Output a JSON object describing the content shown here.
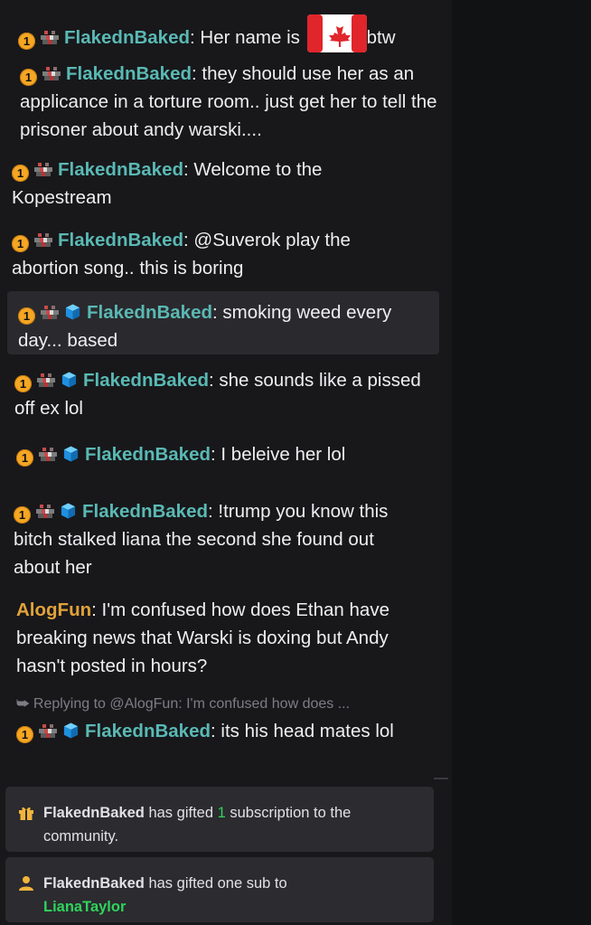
{
  "username": "FlakednBaked",
  "badge_one": "1",
  "messages": [
    {
      "text": "Her name is ",
      "tail": "btw"
    },
    {
      "text": "they should use her as an applicance in a torture room.. just get her to tell the prisoner about andy warski...."
    },
    {
      "text": "Welcome to the Kopestream"
    },
    {
      "text": "@Suverok play the abortion song.. this is boring"
    },
    {
      "text": "smoking weed every day... based"
    },
    {
      "text": "she sounds like a pissed off ex lol"
    },
    {
      "text": "I beleive her lol"
    },
    {
      "text": "!trump you know this bitch stalked liana the second she found out about her"
    },
    {
      "user": "AlogFun",
      "text": "I'm confused how does Ethan have breaking news that Warski is doxing but Andy hasn't posted in hours?"
    },
    {
      "text": "its his head mates lol"
    }
  ],
  "reply": {
    "text": "Replying to @AlogFun: I'm confused how does ..."
  },
  "notices": [
    {
      "icon": "gift-icon",
      "user": "FlakednBaked",
      "pre": " has gifted ",
      "count": "1",
      "post": " subscription to the community."
    },
    {
      "icon": "person-icon",
      "user": "FlakednBaked",
      "pre": " has gifted one sub to ",
      "recipient": "LianaTaylor"
    }
  ],
  "colors": {
    "user": "#5ab9b4",
    "alt_user": "#e0a23a",
    "green": "#2fd45a"
  },
  "icons": [
    "canada-flag-icon",
    "cube-badge-icon",
    "pixel-badge-icon"
  ]
}
